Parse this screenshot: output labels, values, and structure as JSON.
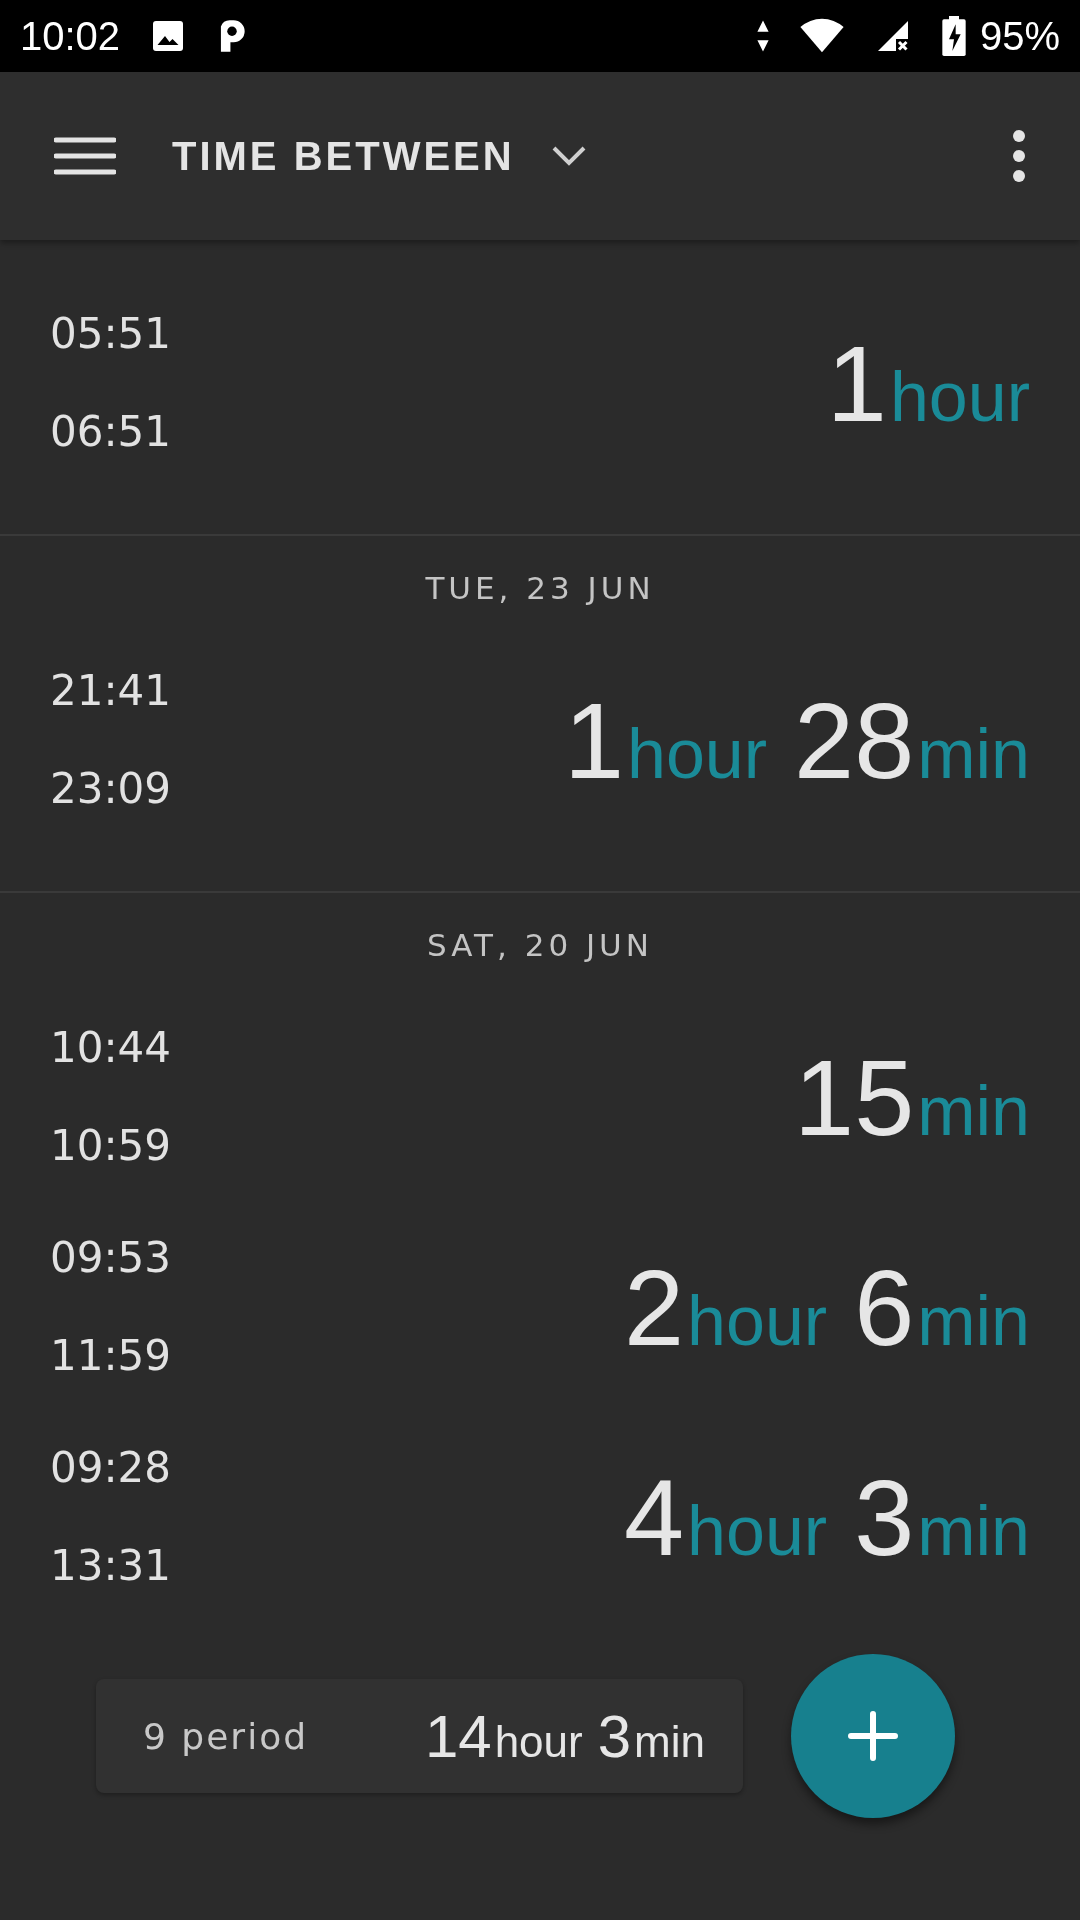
{
  "status_bar": {
    "time": "10:02",
    "battery": "95%"
  },
  "app_bar": {
    "title": "TIME BETWEEN"
  },
  "groups": [
    {
      "entries": [
        {
          "start": "05:51",
          "end": "06:51",
          "duration": [
            {
              "number": "1",
              "unit": "hour"
            }
          ]
        }
      ]
    },
    {
      "header": "TUE, 23 JUN",
      "entries": [
        {
          "start": "21:41",
          "end": "23:09",
          "duration": [
            {
              "number": "1",
              "unit": "hour"
            },
            {
              "number": "28",
              "unit": "min"
            }
          ]
        }
      ]
    },
    {
      "header": "SAT, 20 JUN",
      "entries": [
        {
          "start": "10:44",
          "end": "10:59",
          "duration": [
            {
              "number": "15",
              "unit": "min"
            }
          ]
        },
        {
          "start": "09:53",
          "end": "11:59",
          "duration": [
            {
              "number": "2",
              "unit": "hour"
            },
            {
              "number": "6",
              "unit": "min"
            }
          ]
        },
        {
          "start": "09:28",
          "end": "13:31",
          "duration": [
            {
              "number": "4",
              "unit": "hour"
            },
            {
              "number": "3",
              "unit": "min"
            }
          ]
        }
      ]
    }
  ],
  "summary": {
    "count": "9 period",
    "total": [
      {
        "number": "14",
        "unit": "hour"
      },
      {
        "number": "3",
        "unit": "min"
      }
    ]
  }
}
